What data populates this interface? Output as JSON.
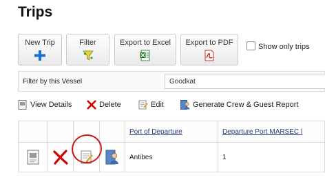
{
  "page": {
    "title": "Trips"
  },
  "toolbar": {
    "new_trip": "New Trip",
    "filter": "Filter",
    "export_excel": "Export to Excel",
    "export_pdf": "Export to PDF",
    "show_only": "Show only trips"
  },
  "filter": {
    "label": "Filter by this Vessel",
    "value": "Goodkat"
  },
  "actions": {
    "view": "View Details",
    "delete": "Delete",
    "edit": "Edit",
    "report": "Generate Crew & Guest Report"
  },
  "table": {
    "columns": [
      "Port of Departure",
      "Departure Port MARSEC l"
    ],
    "rows": [
      {
        "port": "Antibes",
        "marsec": "1"
      }
    ]
  },
  "colors": {
    "accent": "#2a3a7a",
    "highlight_circle": "#d01818",
    "delete_red": "#d40000"
  }
}
